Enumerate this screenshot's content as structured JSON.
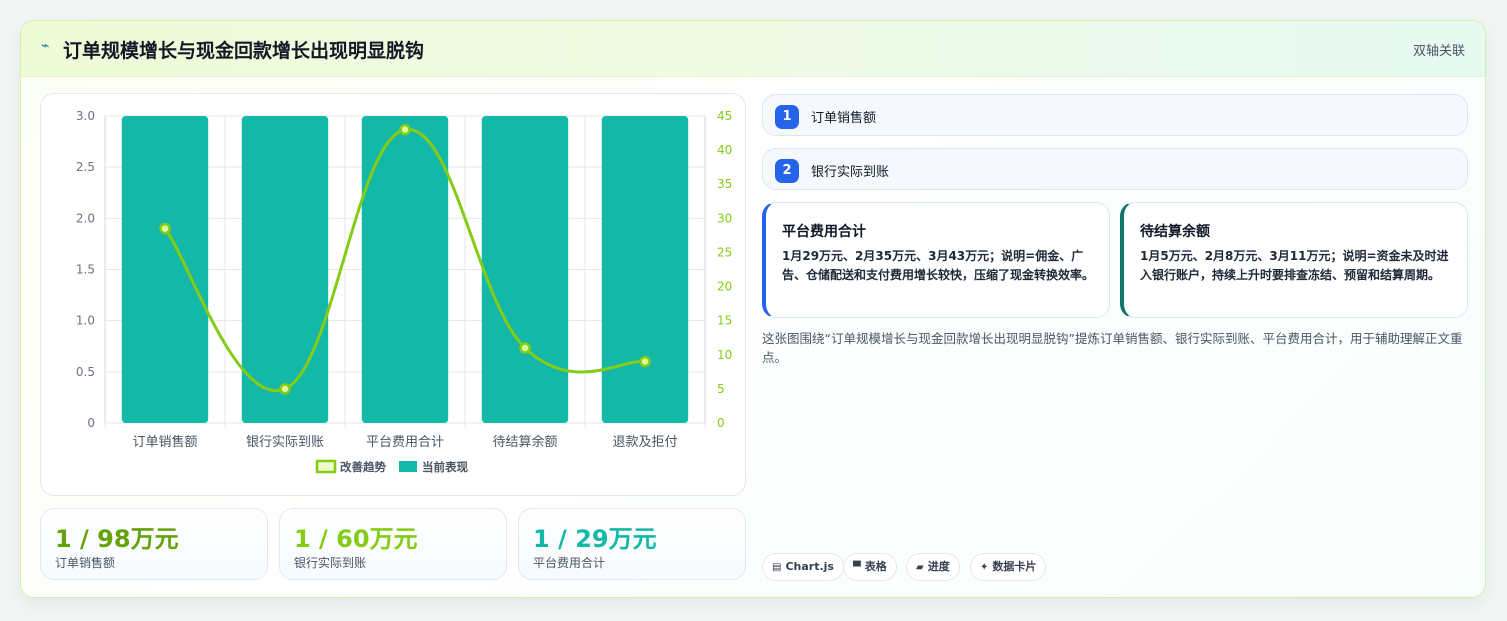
{
  "header": {
    "title": "订单规模增长与现金回款增长出现明显脱钩",
    "tag": "双轴关联"
  },
  "chart_data": {
    "type": "bar",
    "categories": [
      "订单销售额",
      "银行实际到账",
      "平台费用合计",
      "待结算余额",
      "退款及拒付"
    ],
    "series": [
      {
        "name": "当前表现",
        "type": "bar",
        "axis": "left",
        "color": "#14b8a6",
        "values": [
          3,
          3,
          3,
          3,
          3
        ]
      },
      {
        "name": "改善趋势",
        "type": "line",
        "axis": "right",
        "color": "#84cc16",
        "values": [
          28.5,
          5,
          43,
          11,
          9
        ]
      }
    ],
    "y_left": {
      "min": 0,
      "max": 3,
      "ticks": [
        "0",
        "0.5",
        "1.0",
        "1.5",
        "2.0",
        "2.5",
        "3.0"
      ]
    },
    "y_right": {
      "min": 0,
      "max": 45,
      "ticks": [
        "0",
        "5",
        "10",
        "15",
        "20",
        "25",
        "30",
        "35",
        "40",
        "45"
      ]
    },
    "grid": true,
    "legend": "bottom"
  },
  "kpis": [
    {
      "value": "1 / 98万元",
      "label": "订单销售额",
      "color": "#65a30d"
    },
    {
      "value": "1 / 60万元",
      "label": "银行实际到账",
      "color": "#84cc16"
    },
    {
      "value": "1 / 29万元",
      "label": "平台费用合计",
      "color": "#14b8a6"
    }
  ],
  "steps": [
    {
      "num": "1",
      "label": "订单销售额"
    },
    {
      "num": "2",
      "label": "银行实际到账"
    }
  ],
  "notes": [
    {
      "title": "平台费用合计",
      "body": "1月29万元、2月35万元、3月43万元；说明=佣金、广告、仓储配送和支付费用增长较快，压缩了现金转换效率。"
    },
    {
      "title": "待结算余额",
      "body": "1月5万元、2月8万元、3月11万元；说明=资金未及时进入银行账户，持续上升时要排查冻结、预留和结算周期。"
    }
  ],
  "summary": "这张图围绕“订单规模增长与现金回款增长出现明显脱钩”提炼订单销售额、银行实际到账、平台费用合计，用于辅助理解正文重点。",
  "chips": [
    {
      "icon": "chart-icon",
      "glyph": "▤",
      "label": "Chart.js"
    },
    {
      "icon": "table-icon",
      "glyph": "▀",
      "label": "表格"
    },
    {
      "icon": "progress-icon",
      "glyph": "▰",
      "label": "进度"
    },
    {
      "icon": "card-icon",
      "glyph": "✦",
      "label": "数据卡片"
    }
  ],
  "colors": {
    "accent": "#84cc16",
    "teal": "#14b8a6",
    "blue": "#2563eb"
  }
}
